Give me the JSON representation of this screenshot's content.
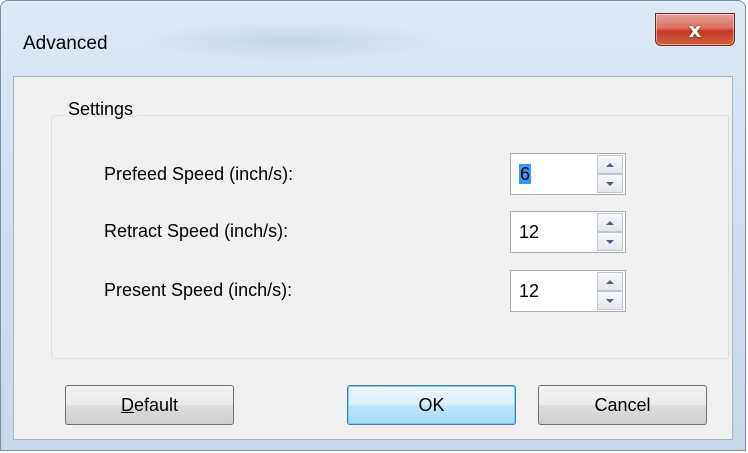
{
  "window": {
    "title": "Advanced",
    "close_glyph": "x"
  },
  "settings": {
    "group_label": "Settings",
    "rows": [
      {
        "label": "Prefeed Speed (inch/s):",
        "value": "6"
      },
      {
        "label": "Retract Speed (inch/s):",
        "value": "12"
      },
      {
        "label": "Present Speed (inch/s):",
        "value": "12"
      }
    ]
  },
  "buttons": {
    "default_label": "Default",
    "ok_label": "OK",
    "cancel_label": "Cancel"
  },
  "icons": {
    "close": "close-icon",
    "up": "chevron-up-icon",
    "down": "chevron-down-icon"
  },
  "colors": {
    "selection": "#3399ff",
    "close_button": "#c43b26",
    "focus_button": "#3c7fb1"
  }
}
